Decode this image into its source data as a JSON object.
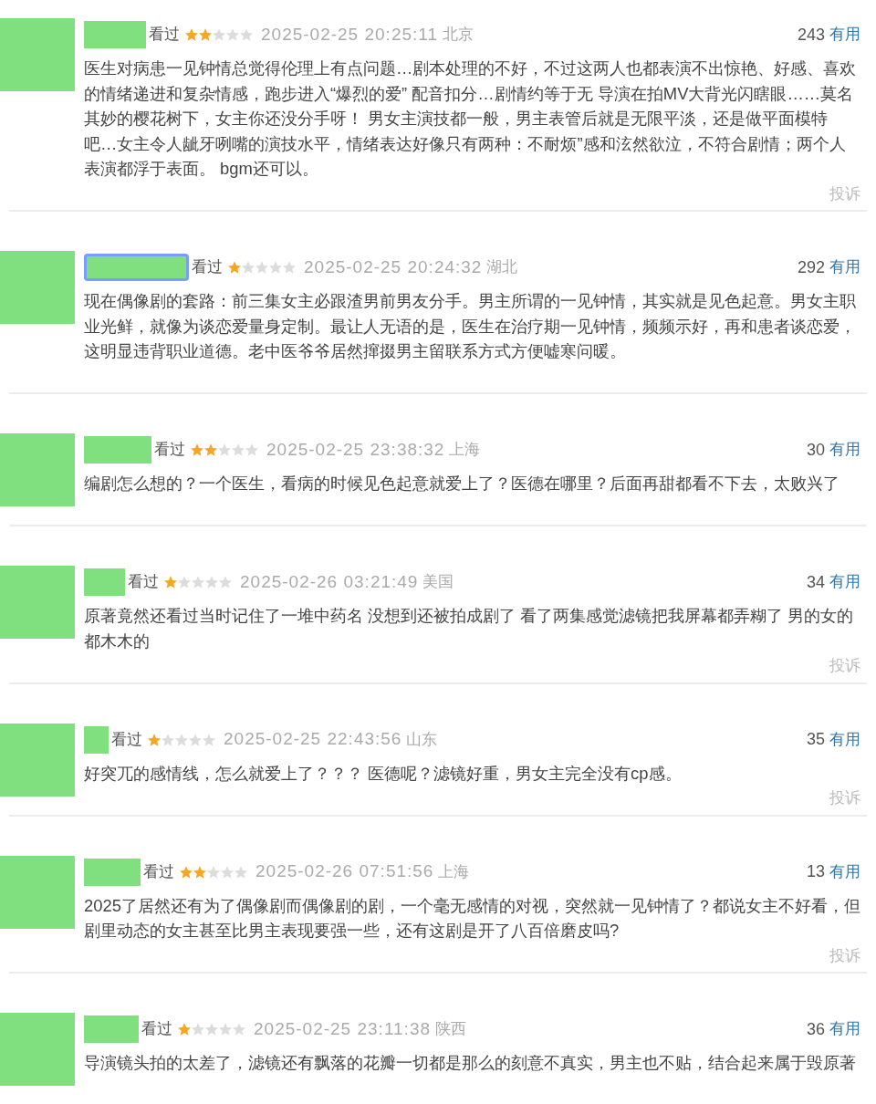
{
  "comments": [
    {
      "username_highlighted": false,
      "status": "看过",
      "stars": 2,
      "time": "2025-02-25 20:25:11",
      "location": "北京",
      "votes": "243",
      "vote_label": "有用",
      "text": "医生对病患一见钟情总觉得伦理上有点问题…剧本处理的不好，不过这两人也都表演不出惊艳、好感、喜欢的情绪递进和复杂情感，跑步进入“爆烈的爱” 配音扣分…剧情约等于无 导演在拍MV大背光闪瞎眼……莫名其妙的樱花树下，女主你还没分手呀！ 男女主演技都一般，男主表管后就是无限平淡，还是做平面模特吧…女主令人龇牙咧嘴的演技水平，情绪表达好像只有两种：不耐烦”感和泫然欲泣，不符合剧情；两个人表演都浮于表面。 bgm还可以。",
      "report": "投诉"
    },
    {
      "username_highlighted": true,
      "status": "看过",
      "stars": 1,
      "time": "2025-02-25 20:24:32",
      "location": "湖北",
      "votes": "292",
      "vote_label": "有用",
      "text": "现在偶像剧的套路：前三集女主必跟渣男前男友分手。男主所谓的一见钟情，其实就是见色起意。男女主职业光鲜，就像为谈恋爱量身定制。最让人无语的是，医生在治疗期一见钟情，频频示好，再和患者谈恋爱，这明显违背职业道德。老中医爷爷居然撺掇男主留联系方式方便嘘寒问暖。"
    },
    {
      "username_highlighted": false,
      "status": "看过",
      "stars": 2,
      "time": "2025-02-25 23:38:32",
      "location": "上海",
      "votes": "30",
      "vote_label": "有用",
      "text": "编剧怎么想的？一个医生，看病的时候见色起意就爱上了？医德在哪里？后面再甜都看不下去，太败兴了"
    },
    {
      "username_highlighted": false,
      "status": "看过",
      "stars": 1,
      "time": "2025-02-26 03:21:49",
      "location": "美国",
      "votes": "34",
      "vote_label": "有用",
      "text": "原著竟然还看过当时记住了一堆中药名 没想到还被拍成剧了 看了两集感觉滤镜把我屏幕都弄糊了 男的女的都木木的",
      "report": "投诉"
    },
    {
      "username_highlighted": false,
      "status": "看过",
      "stars": 1,
      "time": "2025-02-25 22:43:56",
      "location": "山东",
      "votes": "35",
      "vote_label": "有用",
      "text": "好突兀的感情线，怎么就爱上了？？？ 医德呢？滤镜好重，男女主完全没有cp感。",
      "report": "投诉"
    },
    {
      "username_highlighted": false,
      "status": "看过",
      "stars": 2,
      "time": "2025-02-26 07:51:56",
      "location": "上海",
      "votes": "13",
      "vote_label": "有用",
      "text": "2025了居然还有为了偶像剧而偶像剧的剧，一个毫无感情的对视，突然就一见钟情了？都说女主不好看，但剧里动态的女主甚至比男主表现要强一些，还有这剧是开了八百倍磨皮吗?",
      "report": "投诉"
    },
    {
      "username_highlighted": false,
      "status": "看过",
      "stars": 1,
      "time": "2025-02-25 23:11:38",
      "location": "陕西",
      "votes": "36",
      "vote_label": "有用",
      "text": "导演镜头拍的太差了，滤镜还有飘落的花瓣一切都是那么的刻意不真实，男主也不贴，结合起来属于毁原著"
    }
  ]
}
